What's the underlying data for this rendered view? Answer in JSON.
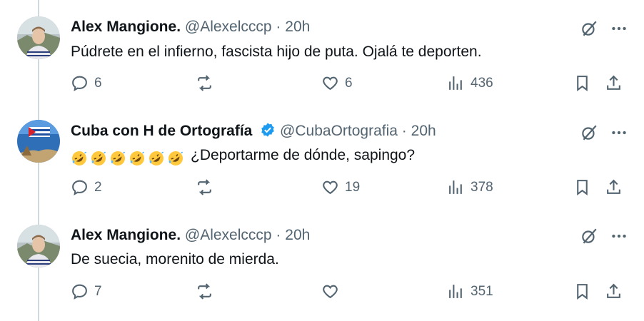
{
  "colors": {
    "text": "#0f1419",
    "secondary": "#536471",
    "verified": "#1d9bf0",
    "thread_line": "#cfd9de"
  },
  "tweets": [
    {
      "name": "Alex Mangione.",
      "handle": "@Alexelcccp",
      "separator": "·",
      "time": "20h",
      "verified": false,
      "emoji_prefix_count": 0,
      "text": "Púdrete en el infierno, fascista hijo de puta. Ojalá te deporten.",
      "replies": "6",
      "reposts": "",
      "likes": "6",
      "views": "436"
    },
    {
      "name": "Cuba con H de Ortografía",
      "handle": "@CubaOrtografia",
      "separator": "·",
      "time": "20h",
      "verified": true,
      "emoji_prefix_count": 6,
      "text": "¿Deportarme de dónde, sapingo?",
      "replies": "2",
      "reposts": "",
      "likes": "19",
      "views": "378"
    },
    {
      "name": "Alex Mangione.",
      "handle": "@Alexelcccp",
      "separator": "·",
      "time": "20h",
      "verified": false,
      "emoji_prefix_count": 0,
      "text": "De suecia, morenito de mierda.",
      "replies": "7",
      "reposts": "",
      "likes": "",
      "views": "351"
    }
  ],
  "icons": {
    "grok": "grok-icon",
    "more": "more-icon",
    "reply": "reply-icon",
    "repost": "repost-icon",
    "like": "like-icon",
    "views": "views-icon",
    "bookmark": "bookmark-icon",
    "share": "share-icon",
    "emoji": "rolling-on-floor-laughing-emoji"
  }
}
